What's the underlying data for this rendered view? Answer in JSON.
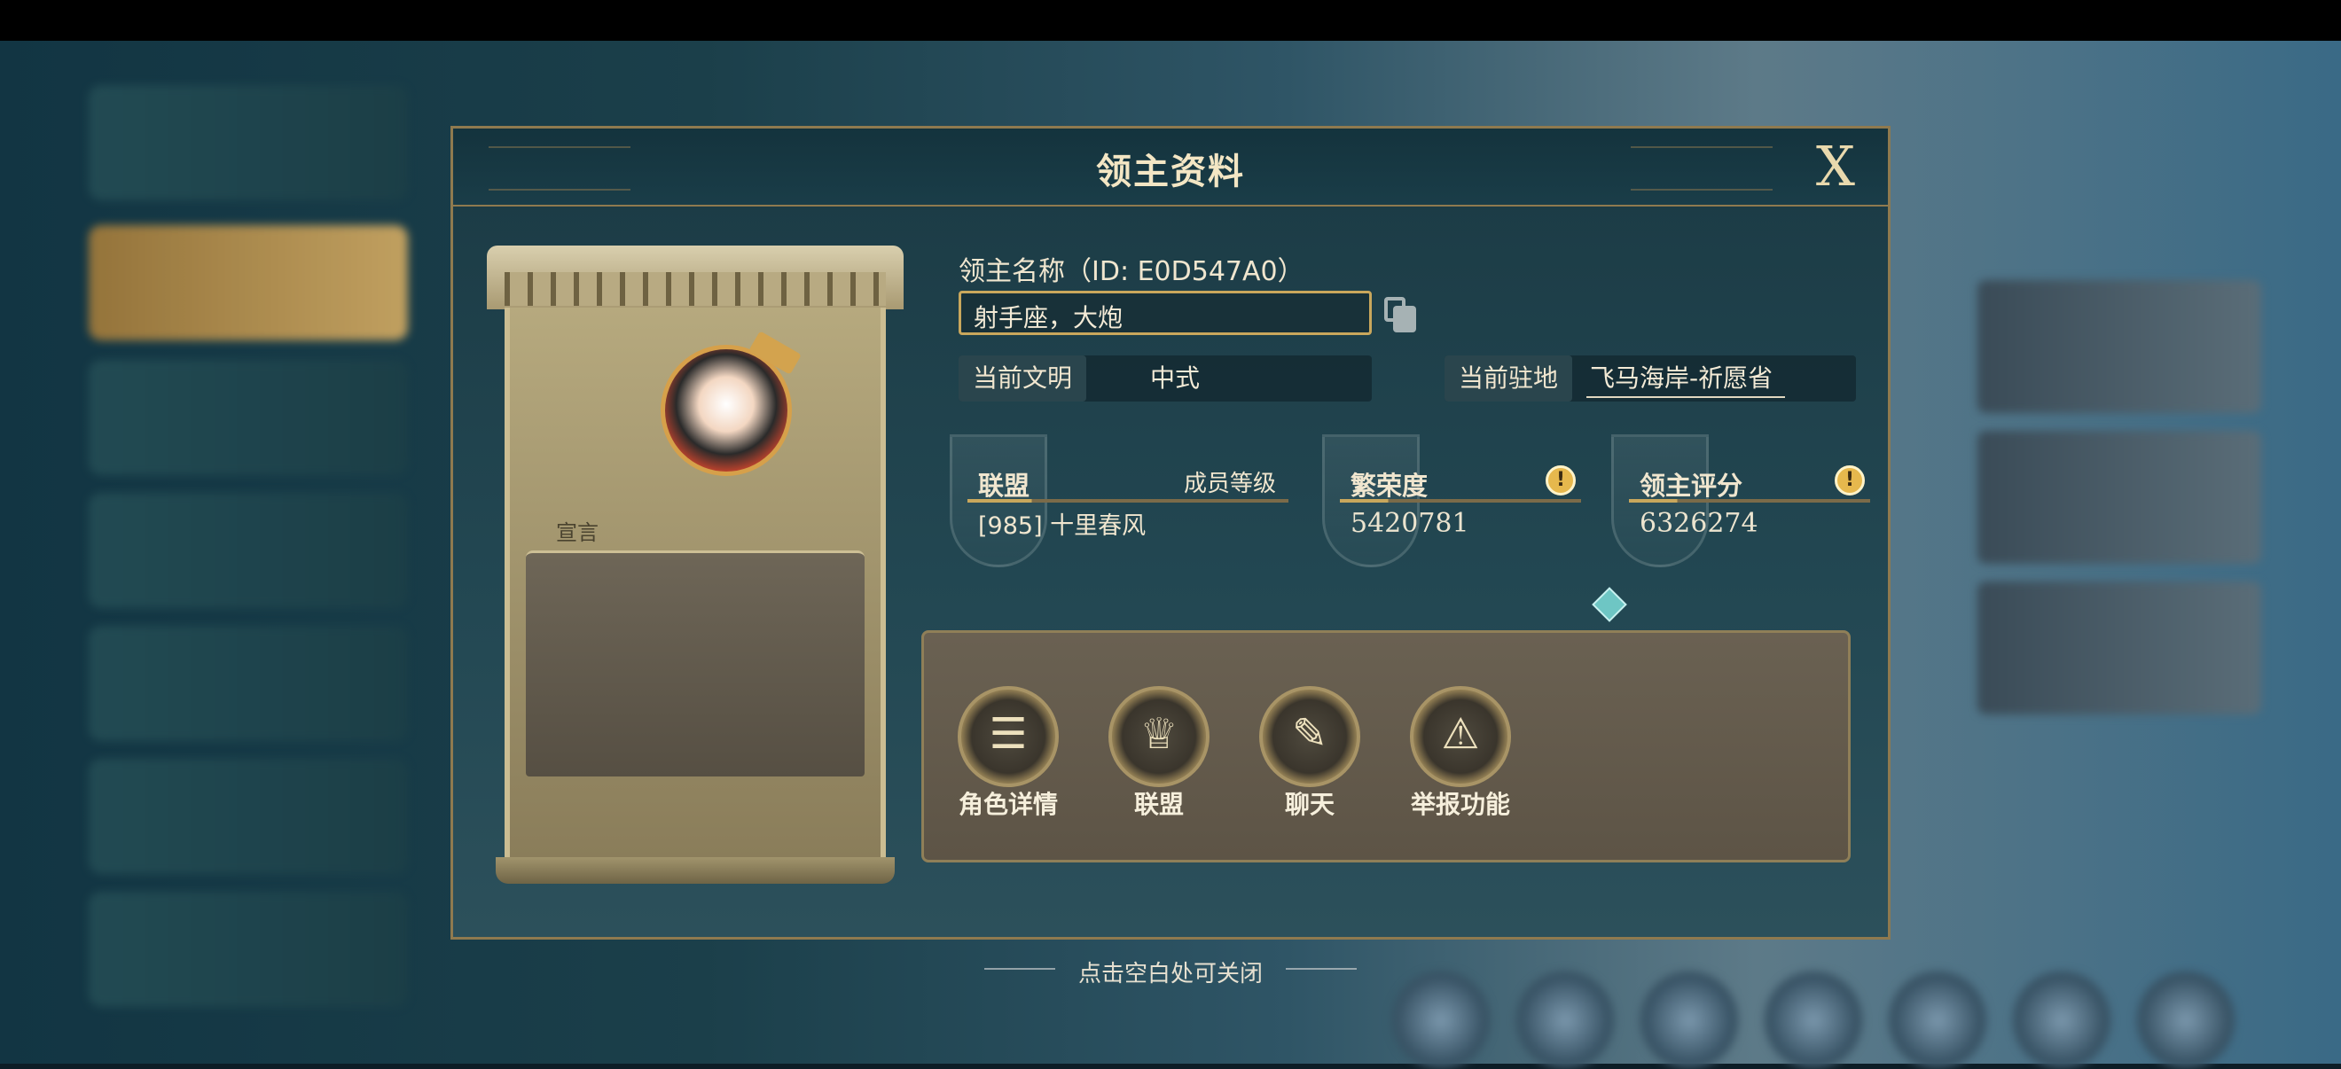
{
  "dialog": {
    "title": "领主资料",
    "close_label": "X"
  },
  "lord": {
    "name_label": "领主名称（ID: E0D547A0）",
    "name_value": "射手座，大炮",
    "civilization_label": "当前文明",
    "civilization_value": "中式",
    "residence_label": "当前驻地",
    "residence_value": "飞马海岸-祈愿省",
    "declaration_label": "宣言"
  },
  "stats": {
    "alliance_title": "联盟",
    "member_rank_label": "成员等级",
    "alliance_value": "[985] 十里春风",
    "prosperity_title": "繁荣度",
    "prosperity_value": "5420781",
    "score_title": "领主评分",
    "score_value": "6326274",
    "info_glyph": "!"
  },
  "actions": [
    {
      "label": "角色详情",
      "icon": "book-icon"
    },
    {
      "label": "联盟",
      "icon": "trophy-icon"
    },
    {
      "label": "聊天",
      "icon": "chat-icon"
    },
    {
      "label": "举报功能",
      "icon": "warning-icon"
    }
  ],
  "hint": "点击空白处可关闭",
  "colors": {
    "accent_gold": "#c9a75c",
    "dialog_bg": "#1b3a44",
    "info_yellow": "#e6b84d"
  }
}
